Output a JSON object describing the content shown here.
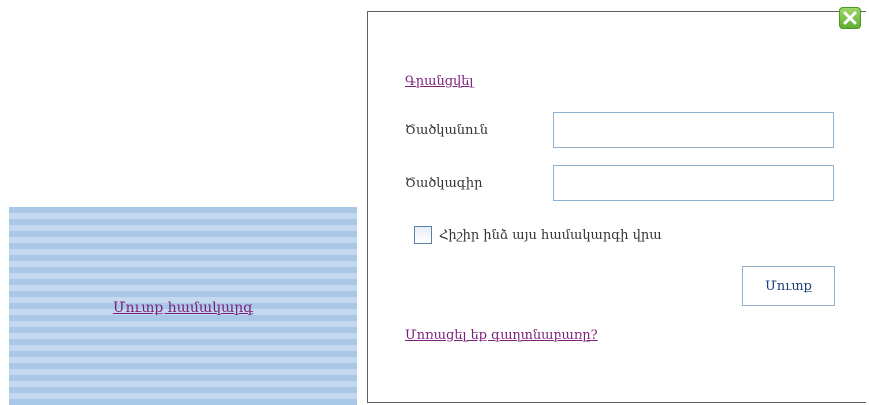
{
  "banner": {
    "link_label": "Մուտք համակարգ"
  },
  "dialog": {
    "close_icon": "close-icon",
    "register_label": "Գրանցվել",
    "username_label": "Ծածկանուն",
    "password_label": "Ծածկագիր",
    "username_value": "",
    "password_value": "",
    "remember_label": "Հիշիր ինձ այս համակարգի վրա",
    "remember_checked": false,
    "submit_label": "Մուտք",
    "forgot_label": "Մոռացել եք գաղտնաբառը?"
  },
  "colors": {
    "link": "#7a1f7a",
    "banner_stripe_dark": "#a9c7e6",
    "banner_stripe_light": "#c4d9ef",
    "input_border": "#8fb0d0",
    "close_button": "#6bbf3a"
  }
}
